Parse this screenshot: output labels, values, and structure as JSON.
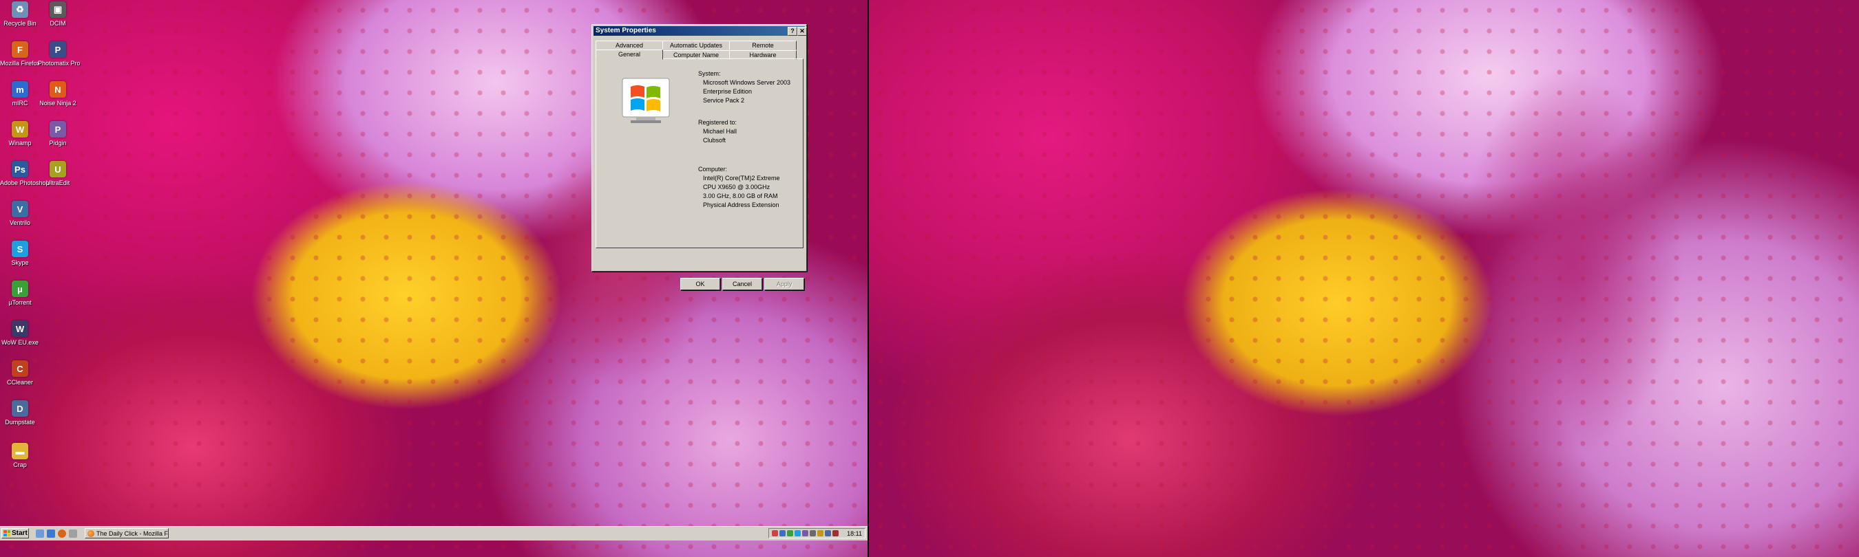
{
  "desktop": {
    "icons": [
      {
        "label": "Recycle Bin",
        "glyph": "♻",
        "color": "#6f8fb8"
      },
      {
        "label": "DCIM",
        "glyph": "▣",
        "color": "#5b5b5b"
      },
      {
        "label": "Mozilla Firefox",
        "glyph": "F",
        "color": "#d9641c"
      },
      {
        "label": "Photomatix Pro",
        "glyph": "P",
        "color": "#3a4d8a"
      },
      {
        "label": "mIRC",
        "glyph": "m",
        "color": "#2d6bd0"
      },
      {
        "label": "Noise Ninja 2",
        "glyph": "N",
        "color": "#e05a1a"
      },
      {
        "label": "Winamp",
        "glyph": "W",
        "color": "#c89416"
      },
      {
        "label": "Pidgin",
        "glyph": "P",
        "color": "#7a5aa8"
      },
      {
        "label": "Adobe Photoshop",
        "glyph": "Ps",
        "color": "#2a5aa0"
      },
      {
        "label": "UltraEdit",
        "glyph": "U",
        "color": "#a8a020"
      },
      {
        "label": "Ventrilo",
        "glyph": "V",
        "color": "#3a6ea5"
      },
      {
        "label": "Skype",
        "glyph": "S",
        "color": "#1ea0e0"
      },
      {
        "label": "µTorrent",
        "glyph": "µ",
        "color": "#3aa038"
      },
      {
        "label": "WoW EU.exe",
        "glyph": "W",
        "color": "#3a3a6a"
      },
      {
        "label": "CCleaner",
        "glyph": "C",
        "color": "#c04020"
      },
      {
        "label": "Dumpstate",
        "glyph": "D",
        "color": "#4a6aa0"
      },
      {
        "label": "Crap",
        "glyph": "▬",
        "color": "#e3b43a"
      }
    ]
  },
  "dialog": {
    "title": "System Properties",
    "help_glyph": "?",
    "close_glyph": "✕",
    "tabs_back": [
      "Advanced",
      "Automatic Updates",
      "Remote"
    ],
    "tabs_front": [
      "General",
      "Computer Name",
      "Hardware"
    ],
    "system_heading": "System:",
    "system_lines": [
      "Microsoft Windows Server 2003",
      "Enterprise Edition",
      "Service Pack 2"
    ],
    "registered_heading": "Registered to:",
    "registered_lines": [
      "Michael Hall",
      "Clubsoft"
    ],
    "computer_heading": "Computer:",
    "computer_lines": [
      "Intel(R) Core(TM)2 Extreme",
      "CPU X9650  @ 3.00GHz",
      "3.00 GHz, 8.00 GB of RAM",
      "Physical Address Extension"
    ],
    "ok_label": "OK",
    "cancel_label": "Cancel",
    "apply_label": "Apply"
  },
  "taskbar": {
    "start_label": "Start",
    "task_item_label": "The Daily Click - Mozilla Fi...",
    "clock": "18:11"
  },
  "colors": {
    "titlebar_start": "#0a246a",
    "titlebar_end": "#3a6ea5",
    "dialog_face": "#d4d0c8"
  }
}
